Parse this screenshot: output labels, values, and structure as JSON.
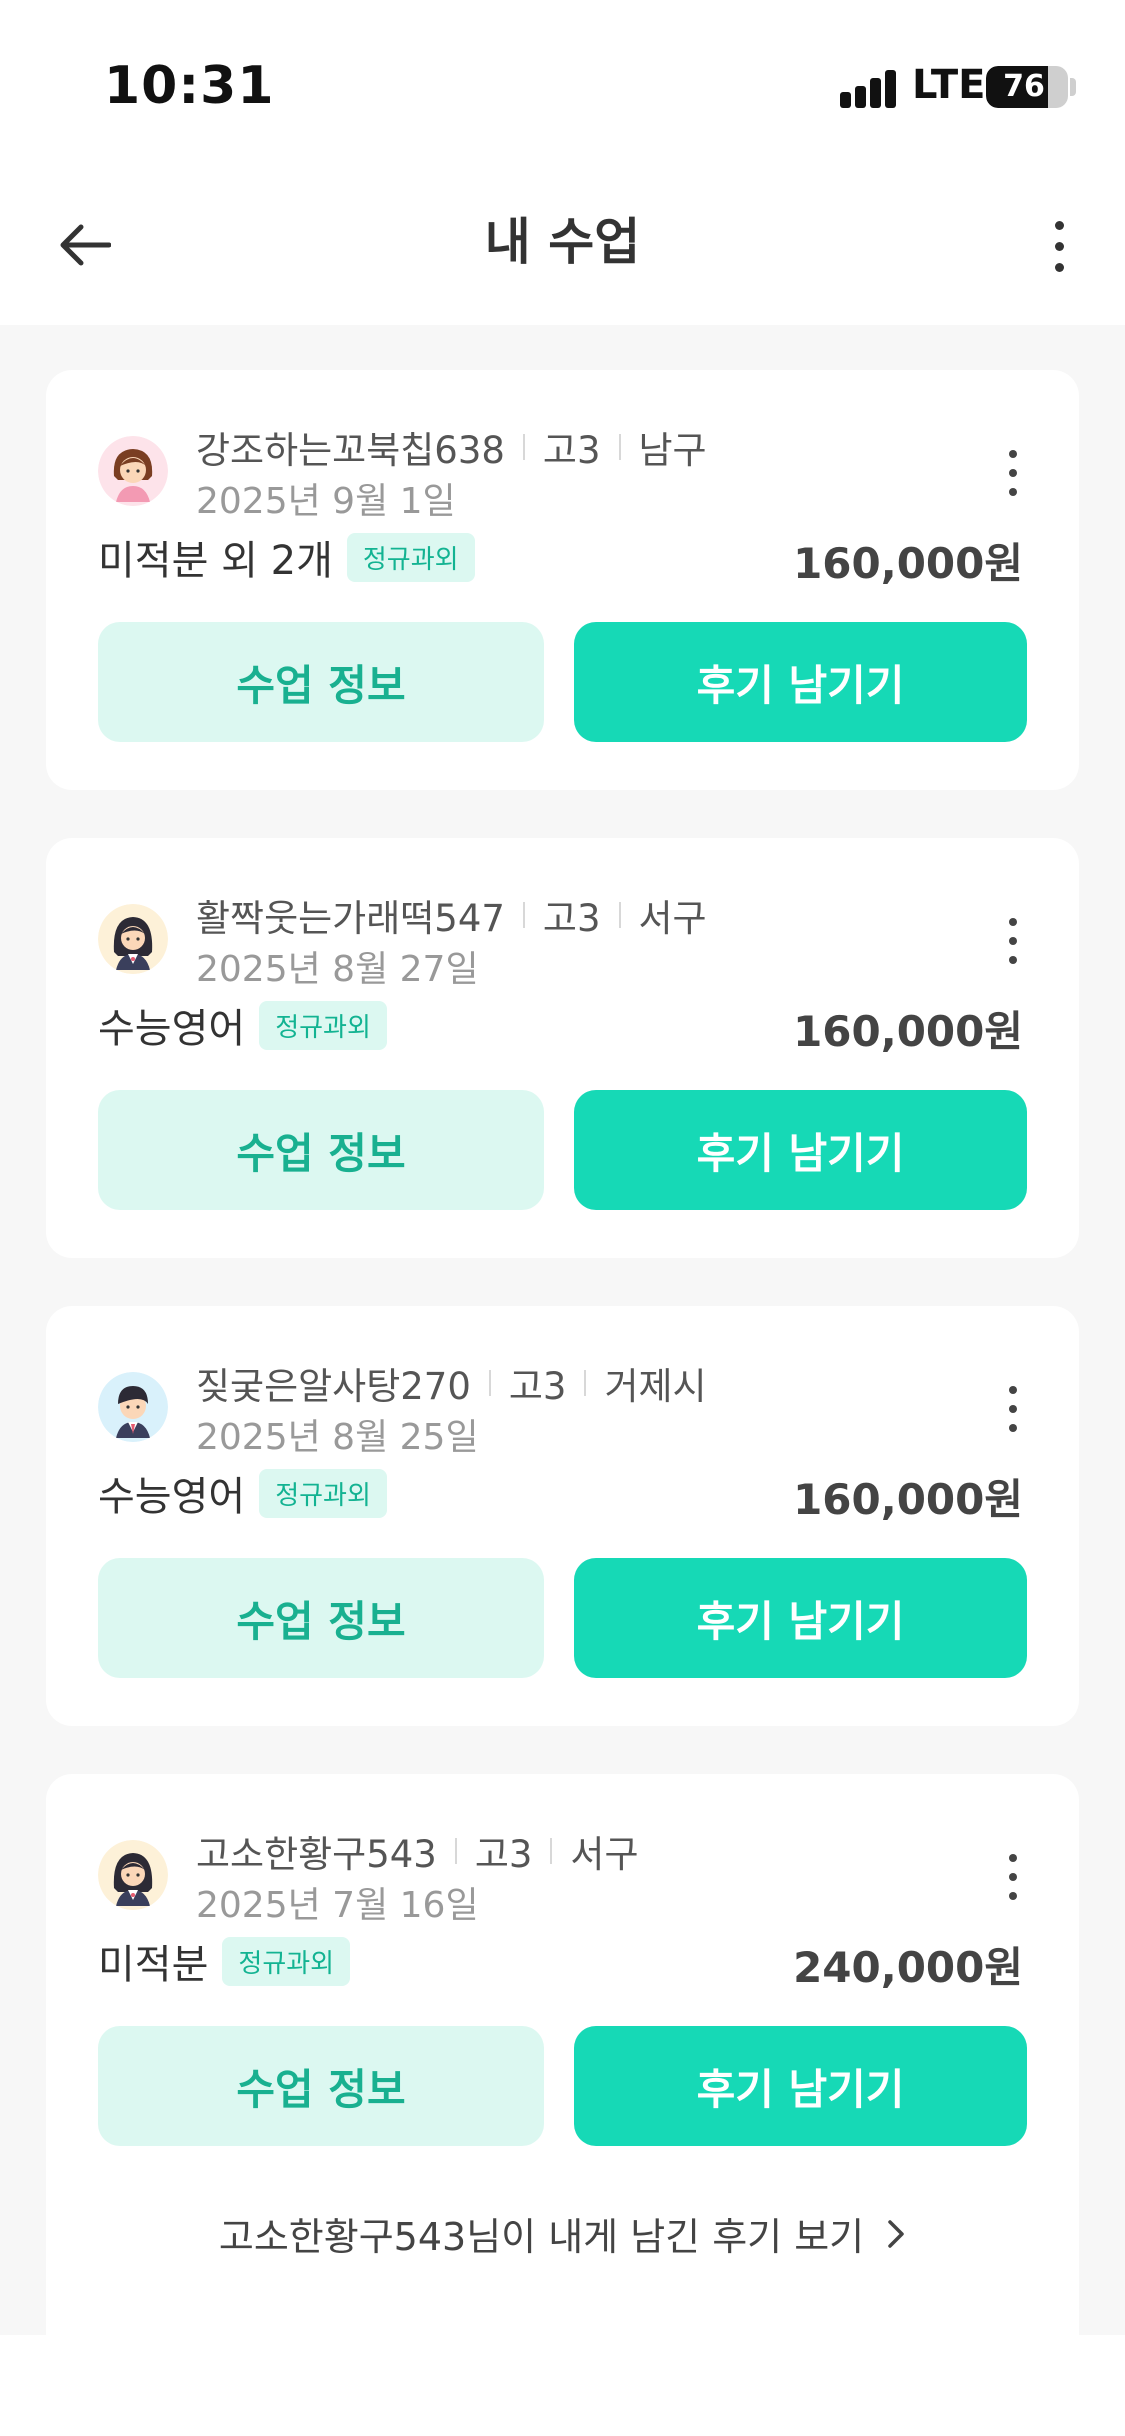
{
  "status_bar": {
    "time": "10:31",
    "network": "LTE",
    "battery": "76",
    "battery_level": 0.76
  },
  "header": {
    "title": "내 수업",
    "back_icon": "back-arrow-icon",
    "menu_icon": "more-vertical-icon"
  },
  "colors": {
    "accent": "#16d9b6",
    "accent_light": "#dcf8f1",
    "accent_text": "#13b392",
    "background": "#f7f7f7"
  },
  "classes": [
    {
      "name": "강조하는꼬북칩638",
      "grade": "고3",
      "region": "남구",
      "date": "2025년 9월 1일",
      "subject": "미적분 외 2개",
      "badge": "정규과외",
      "price": "160,000원",
      "info_button": "수업 정보",
      "review_button": "후기 남기기",
      "avatar_icon": "girl-avatar-icon"
    },
    {
      "name": "활짝웃는가래떡547",
      "grade": "고3",
      "region": "서구",
      "date": "2025년 8월 27일",
      "subject": "수능영어",
      "badge": "정규과외",
      "price": "160,000원",
      "info_button": "수업 정보",
      "review_button": "후기 남기기",
      "avatar_icon": "student-girl-avatar-icon"
    },
    {
      "name": "짖궂은알사탕270",
      "grade": "고3",
      "region": "거제시",
      "date": "2025년 8월 25일",
      "subject": "수능영어",
      "badge": "정규과외",
      "price": "160,000원",
      "info_button": "수업 정보",
      "review_button": "후기 남기기",
      "avatar_icon": "student-boy-avatar-icon"
    },
    {
      "name": "고소한황구543",
      "grade": "고3",
      "region": "서구",
      "date": "2025년 7월 16일",
      "subject": "미적분",
      "badge": "정규과외",
      "price": "240,000원",
      "info_button": "수업 정보",
      "review_button": "후기 남기기",
      "avatar_icon": "student-girl-avatar-icon",
      "review_link": "고소한황구543님이 내게 남긴 후기 보기"
    }
  ]
}
